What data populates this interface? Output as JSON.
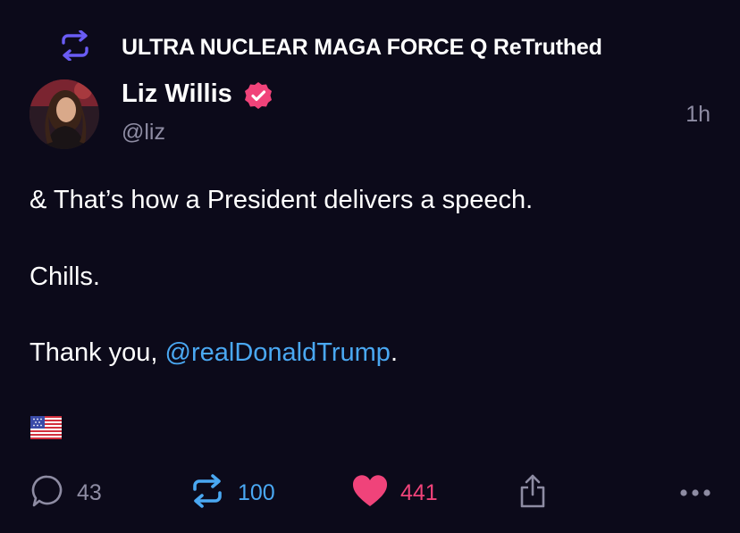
{
  "retruth_header": {
    "label": "ULTRA NUCLEAR MAGA FORCE Q ReTruthed",
    "icon": "retruth-icon"
  },
  "author": {
    "name": "Liz Willis",
    "handle": "@liz",
    "verified_icon": "verified-badge-icon"
  },
  "timestamp": "1h",
  "body": {
    "line1": "& That’s how a President delivers a speech.",
    "line2": "Chills.",
    "line3_prefix": "Thank you, ",
    "line3_mention": "@realDonaldTrump",
    "line3_suffix": ".",
    "emoji": "us-flag-emoji"
  },
  "actions": {
    "replies": "43",
    "retruths": "100",
    "likes": "441",
    "share_icon": "share-icon",
    "more_icon": "more-icon"
  },
  "colors": {
    "background": "#0c0a1a",
    "accent_purple": "#6a5cf5",
    "mention_blue": "#4aa8f2",
    "like_pink": "#f0437a",
    "muted": "#8e8ca3"
  }
}
